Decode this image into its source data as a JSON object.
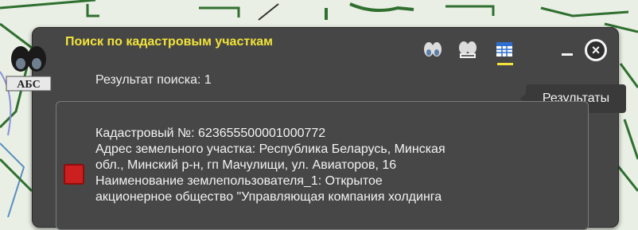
{
  "window": {
    "title": "Поиск по кадастровым участкам"
  },
  "toolbar": {
    "tools": [
      {
        "icon": "binoculars-icon"
      },
      {
        "icon": "binoculars-abc-icon"
      },
      {
        "icon": "table-icon",
        "active": true
      }
    ],
    "minimize_icon": "minimize-icon",
    "close_icon": "close-icon"
  },
  "tooltip": {
    "text": "Результаты"
  },
  "search": {
    "result_label": "Результат поиска: 1"
  },
  "result": {
    "lines": [
      "Кадастровый №: 623655500001000772",
      "Адрес земельного участка: Республика Беларусь, Минская",
      "обл., Минский р-н, гп Мачулищи, ул. Авиаторов, 16",
      "Наименование землепользователя_1: Открытое",
      "акционерное общество \"Управляющая компания холдинга"
    ]
  },
  "logo": {
    "text": "АБС"
  },
  "colors": {
    "panel_bg": "#464646",
    "title": "#f2e33a",
    "marker": "#cc1f1f",
    "map_bg": "#e9efe4"
  }
}
